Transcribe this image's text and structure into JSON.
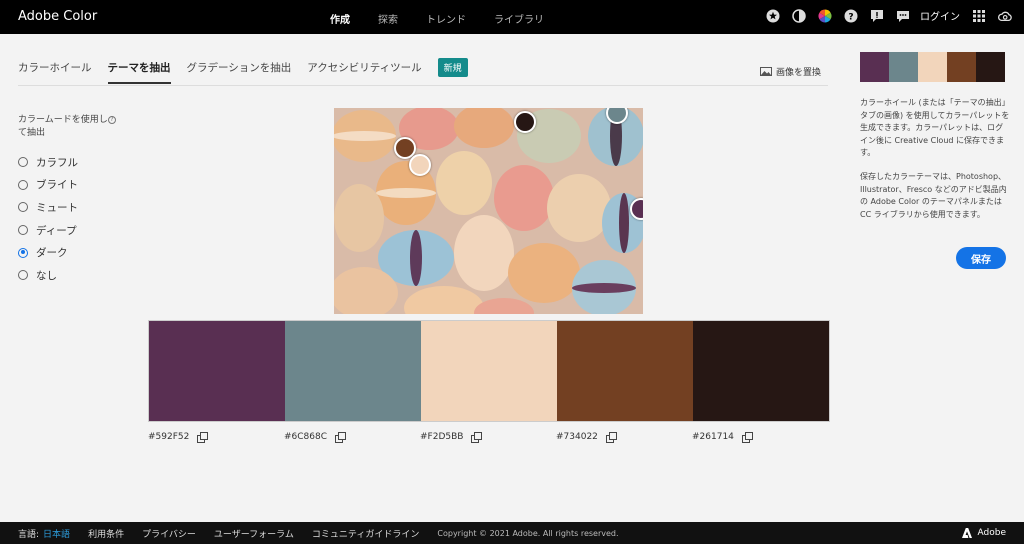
{
  "header": {
    "logo": "Adobe Color",
    "nav": [
      {
        "label": "作成",
        "active": true
      },
      {
        "label": "探索",
        "active": false
      },
      {
        "label": "トレンド",
        "active": false
      },
      {
        "label": "ライブラリ",
        "active": false
      }
    ],
    "login": "ログイン",
    "icons": [
      "star-icon",
      "contrast-icon",
      "color-wheel-icon",
      "help-icon",
      "feedback-icon",
      "chat-icon",
      "apps-grid-icon",
      "creative-cloud-icon"
    ]
  },
  "tabs": [
    {
      "label": "カラーホイール",
      "active": false
    },
    {
      "label": "テーマを抽出",
      "active": true
    },
    {
      "label": "グラデーションを抽出",
      "active": false
    },
    {
      "label": "アクセシビリティツール",
      "active": false
    }
  ],
  "badge": "新規",
  "replace_image": "画像を置換",
  "mode_panel": {
    "title": "カラームードを使用して抽出",
    "options": [
      {
        "label": "カラフル",
        "selected": false
      },
      {
        "label": "ブライト",
        "selected": false
      },
      {
        "label": "ミュート",
        "selected": false
      },
      {
        "label": "ディープ",
        "selected": false
      },
      {
        "label": "ダーク",
        "selected": true
      },
      {
        "label": "なし",
        "selected": false
      }
    ]
  },
  "swatches": [
    {
      "color": "#592F52",
      "hex": "#592F52"
    },
    {
      "color": "#6C868C",
      "hex": "#6C868C"
    },
    {
      "color": "#F2D5BB",
      "hex": "#F2D5BB"
    },
    {
      "color": "#734022",
      "hex": "#734022"
    },
    {
      "color": "#261714",
      "hex": "#261714"
    }
  ],
  "side": {
    "desc1": "カラーホイール (または「テーマの抽出」タブの画像) を使用してカラーパレットを生成できます。カラーパレットは、ログイン後に Creative Cloud に保存できます。",
    "desc2": "保存したカラーテーマは、Photoshop、Illustrator、Fresco などのアドビ製品内の Adobe Color のテーマパネルまたは CC ライブラリから使用できます。",
    "save": "保存"
  },
  "footer": {
    "lang_label": "言語:",
    "lang_value": "日本語",
    "links": [
      "利用条件",
      "プライバシー",
      "ユーザーフォーラム",
      "コミュニティガイドライン"
    ],
    "copyright": "Copyright © 2021 Adobe. All rights reserved.",
    "brand": "Adobe"
  },
  "colors": {
    "accent": "#1473e6",
    "badge": "#148b8b"
  }
}
